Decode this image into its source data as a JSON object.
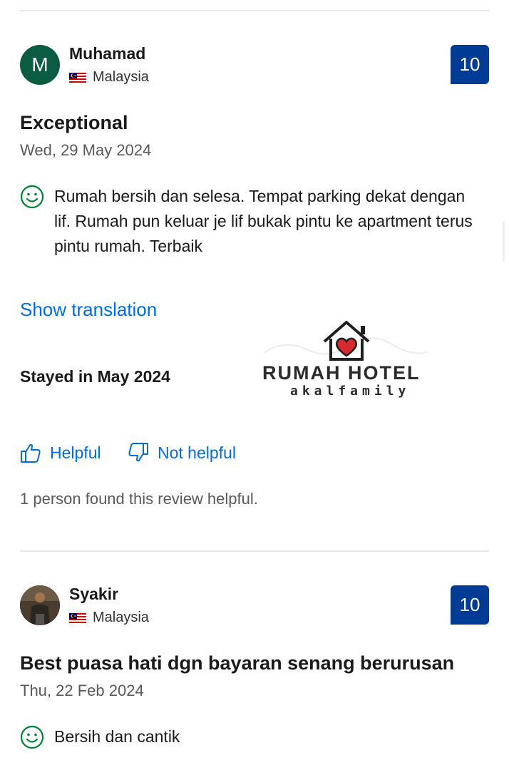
{
  "reviews": [
    {
      "avatar_letter": "M",
      "avatar_color": "#0c5c43",
      "reviewer_name": "Muhamad",
      "country": "Malaysia",
      "score": "10",
      "title": "Exceptional",
      "date": "Wed, 29 May 2024",
      "positive_text": "Rumah bersih dan selesa. Tempat parking dekat dengan lif. Rumah pun keluar je lif bukak pintu ke apartment terus pintu rumah. Terbaik",
      "show_translation": "Show translation",
      "stayed": "Stayed in May 2024",
      "helpful_label": "Helpful",
      "not_helpful_label": "Not helpful",
      "helpful_count_text": "1 person found this review helpful."
    },
    {
      "reviewer_name": "Syakir",
      "country": "Malaysia",
      "score": "10",
      "title": "Best puasa hati dgn bayaran senang berurusan",
      "date": "Thu, 22 Feb 2024",
      "positive_text": "Bersih dan cantik"
    }
  ],
  "watermark": {
    "brand": "RUMAH HOTEL",
    "tagline": "akalfamily"
  },
  "colors": {
    "score_bg": "#003b95",
    "link": "#006ce4",
    "positive_icon": "#008234"
  },
  "icons": [
    "malaysia-flag",
    "smiley-positive-icon",
    "thumbs-up-icon",
    "thumbs-down-icon",
    "house-heart-logo"
  ]
}
